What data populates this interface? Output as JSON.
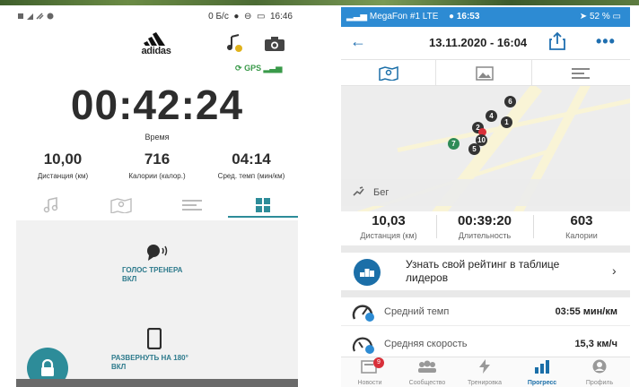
{
  "left_app": {
    "status_bar": {
      "speed": "0 Б/с",
      "time": "16:46"
    },
    "brand": "adidas",
    "gps_label": "GPS",
    "timer": {
      "value": "00:42:24",
      "label": "Время"
    },
    "stats": [
      {
        "value": "10,00",
        "label": "Дистанция (км)"
      },
      {
        "value": "716",
        "label": "Калории (калор.)"
      },
      {
        "value": "04:14",
        "label": "Сред. темп (мин/км)"
      }
    ],
    "tabs": [
      {
        "icon": "music-note-icon"
      },
      {
        "icon": "map-icon"
      },
      {
        "icon": "list-icon"
      },
      {
        "icon": "grid-icon",
        "active": true
      }
    ],
    "controls": {
      "voice_coach": {
        "label": "ГОЛОС ТРЕНЕРА",
        "state": "ВКЛ"
      },
      "rotate": {
        "label": "РАЗВЕРНУТЬ НА 180°",
        "state": "ВКЛ"
      }
    },
    "accent_color": "#2d8c99"
  },
  "right_app": {
    "status_bar": {
      "carrier": "MegaFon #1",
      "network": "LTE",
      "time": "16:53",
      "battery": "52 %"
    },
    "header": {
      "title": "13.11.2020 - 16:04"
    },
    "tabs": [
      {
        "icon": "map-icon"
      },
      {
        "icon": "photo-icon"
      },
      {
        "icon": "list-icon"
      }
    ],
    "map": {
      "activity_label": "Бег",
      "markers": [
        "1",
        "2",
        "3",
        "4",
        "5",
        "6",
        "7",
        "10"
      ]
    },
    "stats": [
      {
        "value": "10,03",
        "label": "Дистанция (км)"
      },
      {
        "value": "00:39:20",
        "label": "Длительность"
      },
      {
        "value": "603",
        "label": "Калории"
      }
    ],
    "leaderboard": {
      "text": "Узнать свой рейтинг в таблице лидеров"
    },
    "metrics": [
      {
        "label": "Средний темп",
        "value": "03:55 мин/км"
      },
      {
        "label": "Средняя скорость",
        "value": "15,3 км/ч"
      }
    ],
    "bottom_nav": [
      {
        "label": "Новости",
        "badge": "9"
      },
      {
        "label": "Сообщество"
      },
      {
        "label": "Тренировка"
      },
      {
        "label": "Прогресс",
        "active": true
      },
      {
        "label": "Профиль"
      }
    ],
    "accent_color": "#1b6fa8"
  }
}
